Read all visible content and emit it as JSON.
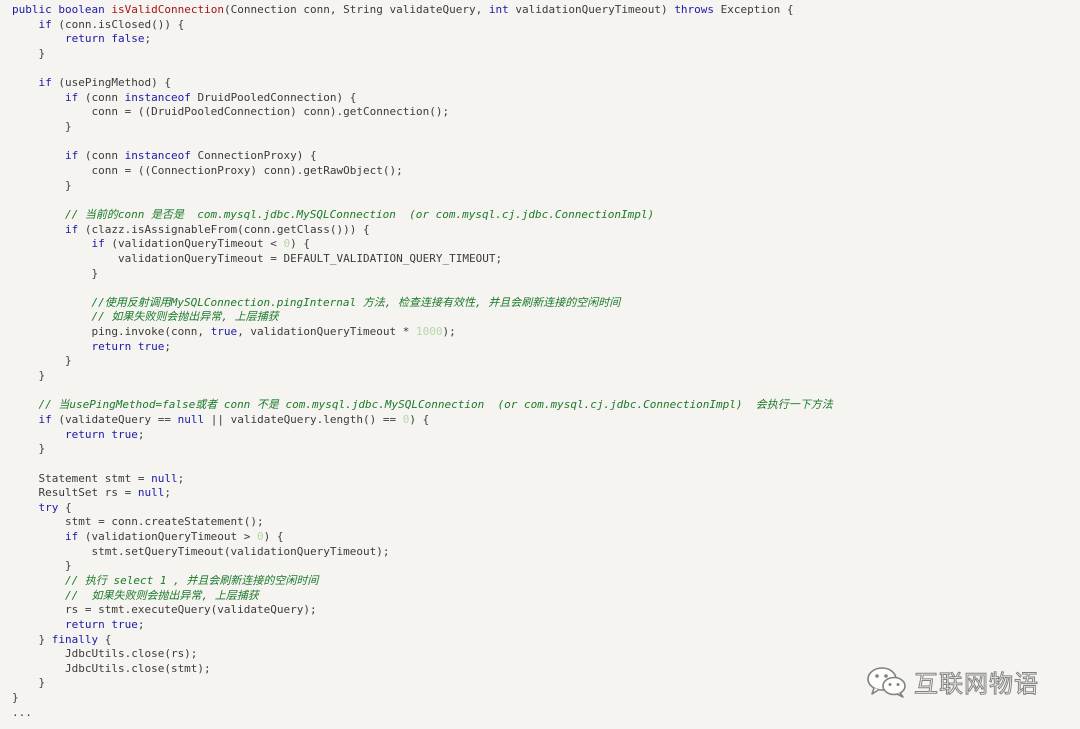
{
  "colors": {
    "background": "#f6f4f0",
    "keyword": "#1a1aa6",
    "method_name": "#a31515",
    "comment": "#197a2a",
    "number": "#b6d7a8",
    "plain": "#3b3b3b"
  },
  "watermark": {
    "icon": "wechat-icon",
    "text": "互联网物语"
  },
  "code": {
    "language": "java",
    "lines": [
      [
        {
          "t": "kw",
          "v": "public"
        },
        {
          "t": "plain",
          "v": " "
        },
        {
          "t": "kw",
          "v": "boolean"
        },
        {
          "t": "plain",
          "v": " "
        },
        {
          "t": "fn",
          "v": "isValidConnection"
        },
        {
          "t": "plain",
          "v": "(Connection conn, String validateQuery, "
        },
        {
          "t": "kw",
          "v": "int"
        },
        {
          "t": "plain",
          "v": " validationQueryTimeout) "
        },
        {
          "t": "kw",
          "v": "throws"
        },
        {
          "t": "plain",
          "v": " Exception {"
        }
      ],
      [
        {
          "t": "plain",
          "v": "    "
        },
        {
          "t": "kw",
          "v": "if"
        },
        {
          "t": "plain",
          "v": " (conn.isClosed()) {"
        }
      ],
      [
        {
          "t": "plain",
          "v": "        "
        },
        {
          "t": "kw",
          "v": "return"
        },
        {
          "t": "plain",
          "v": " "
        },
        {
          "t": "kw",
          "v": "false"
        },
        {
          "t": "plain",
          "v": ";"
        }
      ],
      [
        {
          "t": "plain",
          "v": "    }"
        }
      ],
      [
        {
          "t": "plain",
          "v": ""
        }
      ],
      [
        {
          "t": "plain",
          "v": "    "
        },
        {
          "t": "kw",
          "v": "if"
        },
        {
          "t": "plain",
          "v": " (usePingMethod) {"
        }
      ],
      [
        {
          "t": "plain",
          "v": "        "
        },
        {
          "t": "kw",
          "v": "if"
        },
        {
          "t": "plain",
          "v": " (conn "
        },
        {
          "t": "kw",
          "v": "instanceof"
        },
        {
          "t": "plain",
          "v": " DruidPooledConnection) {"
        }
      ],
      [
        {
          "t": "plain",
          "v": "            conn = ((DruidPooledConnection) conn).getConnection();"
        }
      ],
      [
        {
          "t": "plain",
          "v": "        }"
        }
      ],
      [
        {
          "t": "plain",
          "v": ""
        }
      ],
      [
        {
          "t": "plain",
          "v": "        "
        },
        {
          "t": "kw",
          "v": "if"
        },
        {
          "t": "plain",
          "v": " (conn "
        },
        {
          "t": "kw",
          "v": "instanceof"
        },
        {
          "t": "plain",
          "v": " ConnectionProxy) {"
        }
      ],
      [
        {
          "t": "plain",
          "v": "            conn = ((ConnectionProxy) conn).getRawObject();"
        }
      ],
      [
        {
          "t": "plain",
          "v": "        }"
        }
      ],
      [
        {
          "t": "plain",
          "v": ""
        }
      ],
      [
        {
          "t": "plain",
          "v": "        "
        },
        {
          "t": "cm",
          "v": "// 当前的conn 是否是  com.mysql.jdbc.MySQLConnection  (or com.mysql.cj.jdbc.ConnectionImpl)"
        }
      ],
      [
        {
          "t": "plain",
          "v": "        "
        },
        {
          "t": "kw",
          "v": "if"
        },
        {
          "t": "plain",
          "v": " (clazz.isAssignableFrom(conn.getClass())) {"
        }
      ],
      [
        {
          "t": "plain",
          "v": "            "
        },
        {
          "t": "kw",
          "v": "if"
        },
        {
          "t": "plain",
          "v": " (validationQueryTimeout < "
        },
        {
          "t": "num",
          "v": "0"
        },
        {
          "t": "plain",
          "v": ") {"
        }
      ],
      [
        {
          "t": "plain",
          "v": "                validationQueryTimeout = DEFAULT_VALIDATION_QUERY_TIMEOUT;"
        }
      ],
      [
        {
          "t": "plain",
          "v": "            }"
        }
      ],
      [
        {
          "t": "plain",
          "v": ""
        }
      ],
      [
        {
          "t": "plain",
          "v": "            "
        },
        {
          "t": "cm",
          "v": "//使用反射调用MySQLConnection.pingInternal 方法, 检查连接有效性, 并且会刷新连接的空闲时间"
        }
      ],
      [
        {
          "t": "plain",
          "v": "            "
        },
        {
          "t": "cm",
          "v": "// 如果失败则会抛出异常, 上层捕获"
        }
      ],
      [
        {
          "t": "plain",
          "v": "            ping.invoke(conn, "
        },
        {
          "t": "kw",
          "v": "true"
        },
        {
          "t": "plain",
          "v": ", validationQueryTimeout * "
        },
        {
          "t": "num",
          "v": "1000"
        },
        {
          "t": "plain",
          "v": ");"
        }
      ],
      [
        {
          "t": "plain",
          "v": "            "
        },
        {
          "t": "kw",
          "v": "return"
        },
        {
          "t": "plain",
          "v": " "
        },
        {
          "t": "kw",
          "v": "true"
        },
        {
          "t": "plain",
          "v": ";"
        }
      ],
      [
        {
          "t": "plain",
          "v": "        }"
        }
      ],
      [
        {
          "t": "plain",
          "v": "    }"
        }
      ],
      [
        {
          "t": "plain",
          "v": ""
        }
      ],
      [
        {
          "t": "plain",
          "v": "    "
        },
        {
          "t": "cm",
          "v": "// 当usePingMethod=false或者 conn 不是 com.mysql.jdbc.MySQLConnection  (or com.mysql.cj.jdbc.ConnectionImpl)  会执行一下方法"
        }
      ],
      [
        {
          "t": "plain",
          "v": "    "
        },
        {
          "t": "kw",
          "v": "if"
        },
        {
          "t": "plain",
          "v": " (validateQuery == "
        },
        {
          "t": "kw",
          "v": "null"
        },
        {
          "t": "plain",
          "v": " || validateQuery.length() == "
        },
        {
          "t": "num",
          "v": "0"
        },
        {
          "t": "plain",
          "v": ") {"
        }
      ],
      [
        {
          "t": "plain",
          "v": "        "
        },
        {
          "t": "kw",
          "v": "return"
        },
        {
          "t": "plain",
          "v": " "
        },
        {
          "t": "kw",
          "v": "true"
        },
        {
          "t": "plain",
          "v": ";"
        }
      ],
      [
        {
          "t": "plain",
          "v": "    }"
        }
      ],
      [
        {
          "t": "plain",
          "v": ""
        }
      ],
      [
        {
          "t": "plain",
          "v": "    Statement stmt = "
        },
        {
          "t": "kw",
          "v": "null"
        },
        {
          "t": "plain",
          "v": ";"
        }
      ],
      [
        {
          "t": "plain",
          "v": "    ResultSet rs = "
        },
        {
          "t": "kw",
          "v": "null"
        },
        {
          "t": "plain",
          "v": ";"
        }
      ],
      [
        {
          "t": "plain",
          "v": "    "
        },
        {
          "t": "kw",
          "v": "try"
        },
        {
          "t": "plain",
          "v": " {"
        }
      ],
      [
        {
          "t": "plain",
          "v": "        stmt = conn.createStatement();"
        }
      ],
      [
        {
          "t": "plain",
          "v": "        "
        },
        {
          "t": "kw",
          "v": "if"
        },
        {
          "t": "plain",
          "v": " (validationQueryTimeout > "
        },
        {
          "t": "num",
          "v": "0"
        },
        {
          "t": "plain",
          "v": ") {"
        }
      ],
      [
        {
          "t": "plain",
          "v": "            stmt.setQueryTimeout(validationQueryTimeout);"
        }
      ],
      [
        {
          "t": "plain",
          "v": "        }"
        }
      ],
      [
        {
          "t": "plain",
          "v": "        "
        },
        {
          "t": "cm",
          "v": "// 执行 select 1 , 并且会刷新连接的空闲时间"
        }
      ],
      [
        {
          "t": "plain",
          "v": "        "
        },
        {
          "t": "cm",
          "v": "//  如果失败则会抛出异常, 上层捕获"
        }
      ],
      [
        {
          "t": "plain",
          "v": "        rs = stmt.executeQuery(validateQuery);"
        }
      ],
      [
        {
          "t": "plain",
          "v": "        "
        },
        {
          "t": "kw",
          "v": "return"
        },
        {
          "t": "plain",
          "v": " "
        },
        {
          "t": "kw",
          "v": "true"
        },
        {
          "t": "plain",
          "v": ";"
        }
      ],
      [
        {
          "t": "plain",
          "v": "    } "
        },
        {
          "t": "kw",
          "v": "finally"
        },
        {
          "t": "plain",
          "v": " {"
        }
      ],
      [
        {
          "t": "plain",
          "v": "        JdbcUtils.close(rs);"
        }
      ],
      [
        {
          "t": "plain",
          "v": "        JdbcUtils.close(stmt);"
        }
      ],
      [
        {
          "t": "plain",
          "v": "    }"
        }
      ],
      [
        {
          "t": "plain",
          "v": "}"
        }
      ],
      [
        {
          "t": "plain",
          "v": "..."
        }
      ]
    ]
  }
}
